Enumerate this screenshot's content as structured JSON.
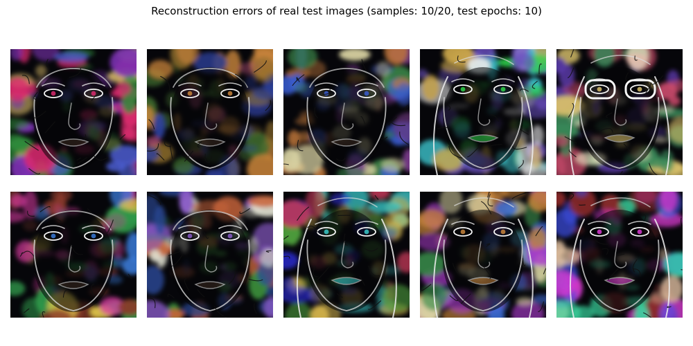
{
  "figure": {
    "title": "Reconstruction errors of real test images (samples: 10/20, test epochs: 10)"
  },
  "images": [
    {
      "row": 1,
      "col": 1,
      "subject": "man",
      "palette": [
        "#d92a6e",
        "#2f8a3a",
        "#4e5fd6",
        "#e0c16b",
        "#7a2fb0"
      ],
      "hair": "short"
    },
    {
      "row": 1,
      "col": 2,
      "subject": "man",
      "palette": [
        "#c8843a",
        "#3f6c2f",
        "#2c3f9a",
        "#d05a8a",
        "#8a6a2a"
      ],
      "hair": "short"
    },
    {
      "row": 1,
      "col": 3,
      "subject": "man",
      "palette": [
        "#3a5cd0",
        "#3b8a4a",
        "#c47a3a",
        "#7b3b8c",
        "#d6d0a0"
      ],
      "hair": "short"
    },
    {
      "row": 1,
      "col": 4,
      "subject": "woman",
      "palette": [
        "#2fd14a",
        "#e8e8e8",
        "#6a4fc0",
        "#c8a44a",
        "#3ac0c8"
      ],
      "hair": "long"
    },
    {
      "row": 1,
      "col": 5,
      "subject": "woman with glasses",
      "palette": [
        "#d8c06a",
        "#5a3aa8",
        "#3a8a5a",
        "#c84a6a",
        "#e8e0c0"
      ],
      "hair": "long"
    },
    {
      "row": 2,
      "col": 1,
      "subject": "man",
      "palette": [
        "#3a7ad8",
        "#d83aa0",
        "#2f9a4a",
        "#e0c84a",
        "#8a3a2a"
      ],
      "hair": "short"
    },
    {
      "row": 2,
      "col": 2,
      "subject": "man",
      "palette": [
        "#8a5ac8",
        "#3a8a3a",
        "#c8643a",
        "#2a4a9a",
        "#e0e0d0"
      ],
      "hair": "short"
    },
    {
      "row": 2,
      "col": 3,
      "subject": "woman",
      "palette": [
        "#3ac8c8",
        "#c83a5a",
        "#2a2ad0",
        "#d0b04a",
        "#4a9a3a"
      ],
      "hair": "long"
    },
    {
      "row": 2,
      "col": 4,
      "subject": "woman",
      "palette": [
        "#c8843a",
        "#a83ac8",
        "#3a6ad0",
        "#d8d0a0",
        "#3a8a4a"
      ],
      "hair": "long"
    },
    {
      "row": 2,
      "col": 5,
      "subject": "woman",
      "palette": [
        "#d83ad0",
        "#3ad8a0",
        "#3a4ad8",
        "#e0c0a0",
        "#8a2a2a"
      ],
      "hair": "long"
    }
  ]
}
